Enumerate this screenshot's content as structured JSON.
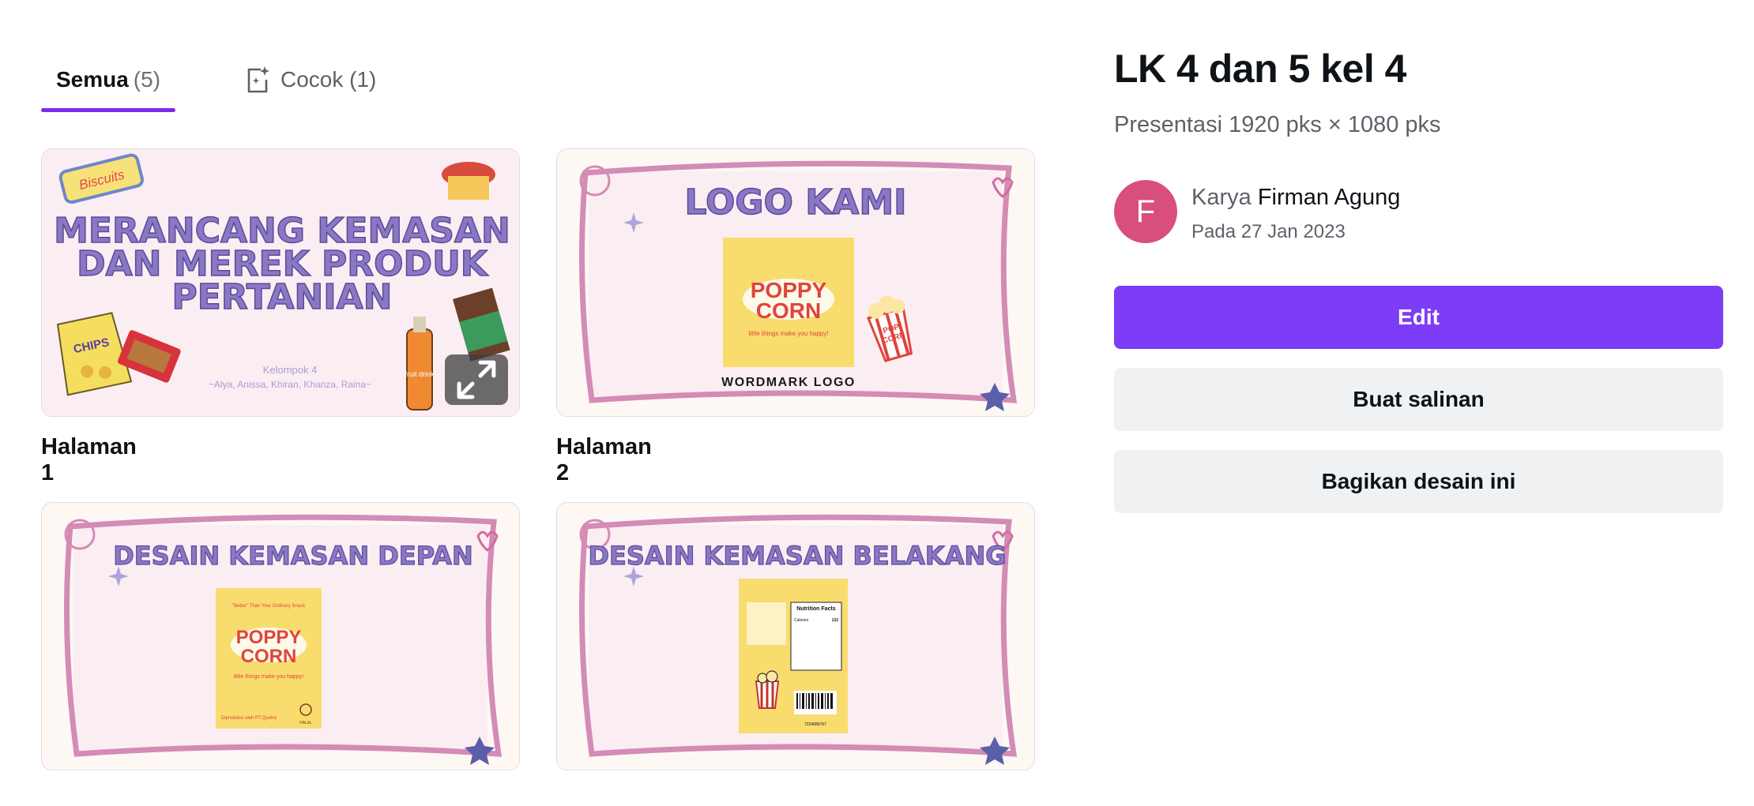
{
  "tabs": [
    {
      "label": "Semua",
      "count": "(5)"
    },
    {
      "label": "Cocok",
      "count": "(1)"
    }
  ],
  "pages": [
    {
      "caption": "Halaman 1",
      "heading_lines": [
        "MERANCANG KEMASAN",
        "DAN MEREK PRODUK",
        "PERTANIAN"
      ],
      "group": "Kelompok 4",
      "members": "~Alya, Anissa, Khiran, Khanza, Raina~",
      "sticker_biscuit": "Biscuits",
      "sticker_chips": "CHIPS",
      "sticker_drink": "fruit drink"
    },
    {
      "caption": "Halaman 2",
      "heading": "LOGO KAMI",
      "brand": [
        "POPPY",
        "CORN"
      ],
      "tagline": "little things make you happy!",
      "footer": "WORDMARK LOGO",
      "popcorn_label": [
        "POP",
        "CORN"
      ]
    },
    {
      "caption": "",
      "heading": "DESAIN KEMASAN DEPAN",
      "pack_top": "\"Better\" Than Your Ordinary Snack",
      "brand": [
        "POPPY",
        "CORN"
      ],
      "tagline": "little things make you happy!",
      "pack_bottom": "Diproduksi oleh PT.Quotra",
      "halal": "HALAL"
    },
    {
      "caption": "",
      "heading": "DESAIN KEMASAN BELAKANG",
      "nutrition_title": "Nutrition Facts",
      "calories_label": "Calories",
      "calories_value": "132",
      "barcode_number": "7224686767"
    }
  ],
  "panel": {
    "title": "LK 4 dan 5 kel 4",
    "subtitle": "Presentasi 1920 pks × 1080 pks",
    "avatar_letter": "F",
    "author_prefix": "Karya",
    "author_name": "Firman Agung",
    "date": "Pada 27 Jan 2023",
    "edit_label": "Edit",
    "copy_label": "Buat salinan",
    "share_label": "Bagikan desain ini"
  },
  "colors": {
    "accent": "#7d3cf6",
    "tab_underline": "#7d2ae8",
    "avatar": "#d94f7b",
    "slide_title": "#8a78c4",
    "frame_pink": "#d48bb6",
    "pack_yellow": "#f9dc6e",
    "brand_red": "#e0443c"
  },
  "icons": {
    "match_tab": "sparkle-document-icon",
    "expand": "expand-arrows-icon"
  }
}
